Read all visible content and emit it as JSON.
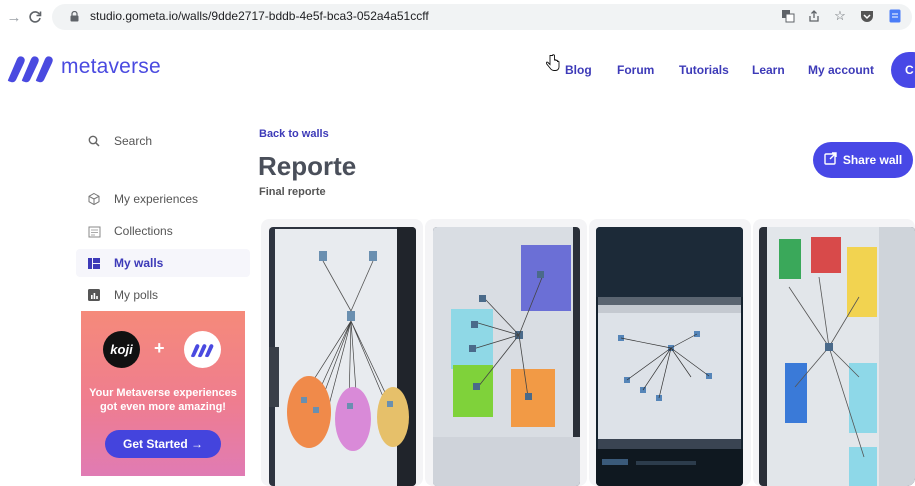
{
  "browser": {
    "url": "studio.gometa.io/walls/9dde2717-bddb-4e5f-bca3-052a4a51ccff"
  },
  "header": {
    "logo_text": "metaverse",
    "nav": [
      "Blog",
      "Forum",
      "Tutorials",
      "Learn",
      "My account"
    ],
    "cta_cut": "C"
  },
  "sidebar": {
    "items": [
      {
        "label": "Search",
        "icon": "search-icon"
      },
      {
        "label": "My experiences",
        "icon": "cube-icon"
      },
      {
        "label": "Collections",
        "icon": "collection-icon"
      },
      {
        "label": "My walls",
        "icon": "grid-icon",
        "active": true
      },
      {
        "label": "My polls",
        "icon": "chart-icon"
      }
    ],
    "promo": {
      "koji": "koji",
      "plus": "+",
      "text": "Your Metaverse experiences got even more amazing!",
      "button": "Get Started →"
    }
  },
  "main": {
    "back_link": "Back to walls",
    "title": "Reporte",
    "subtitle": "Final reporte",
    "share_button": "Share wall",
    "cards": [
      {
        "id": "network-diagram-photo-1"
      },
      {
        "id": "network-diagram-photo-2"
      },
      {
        "id": "screen-photo-3"
      },
      {
        "id": "whiteboard-photo-4"
      }
    ]
  },
  "colors": {
    "brand": "#4848e6",
    "link": "#3d3ab8"
  }
}
